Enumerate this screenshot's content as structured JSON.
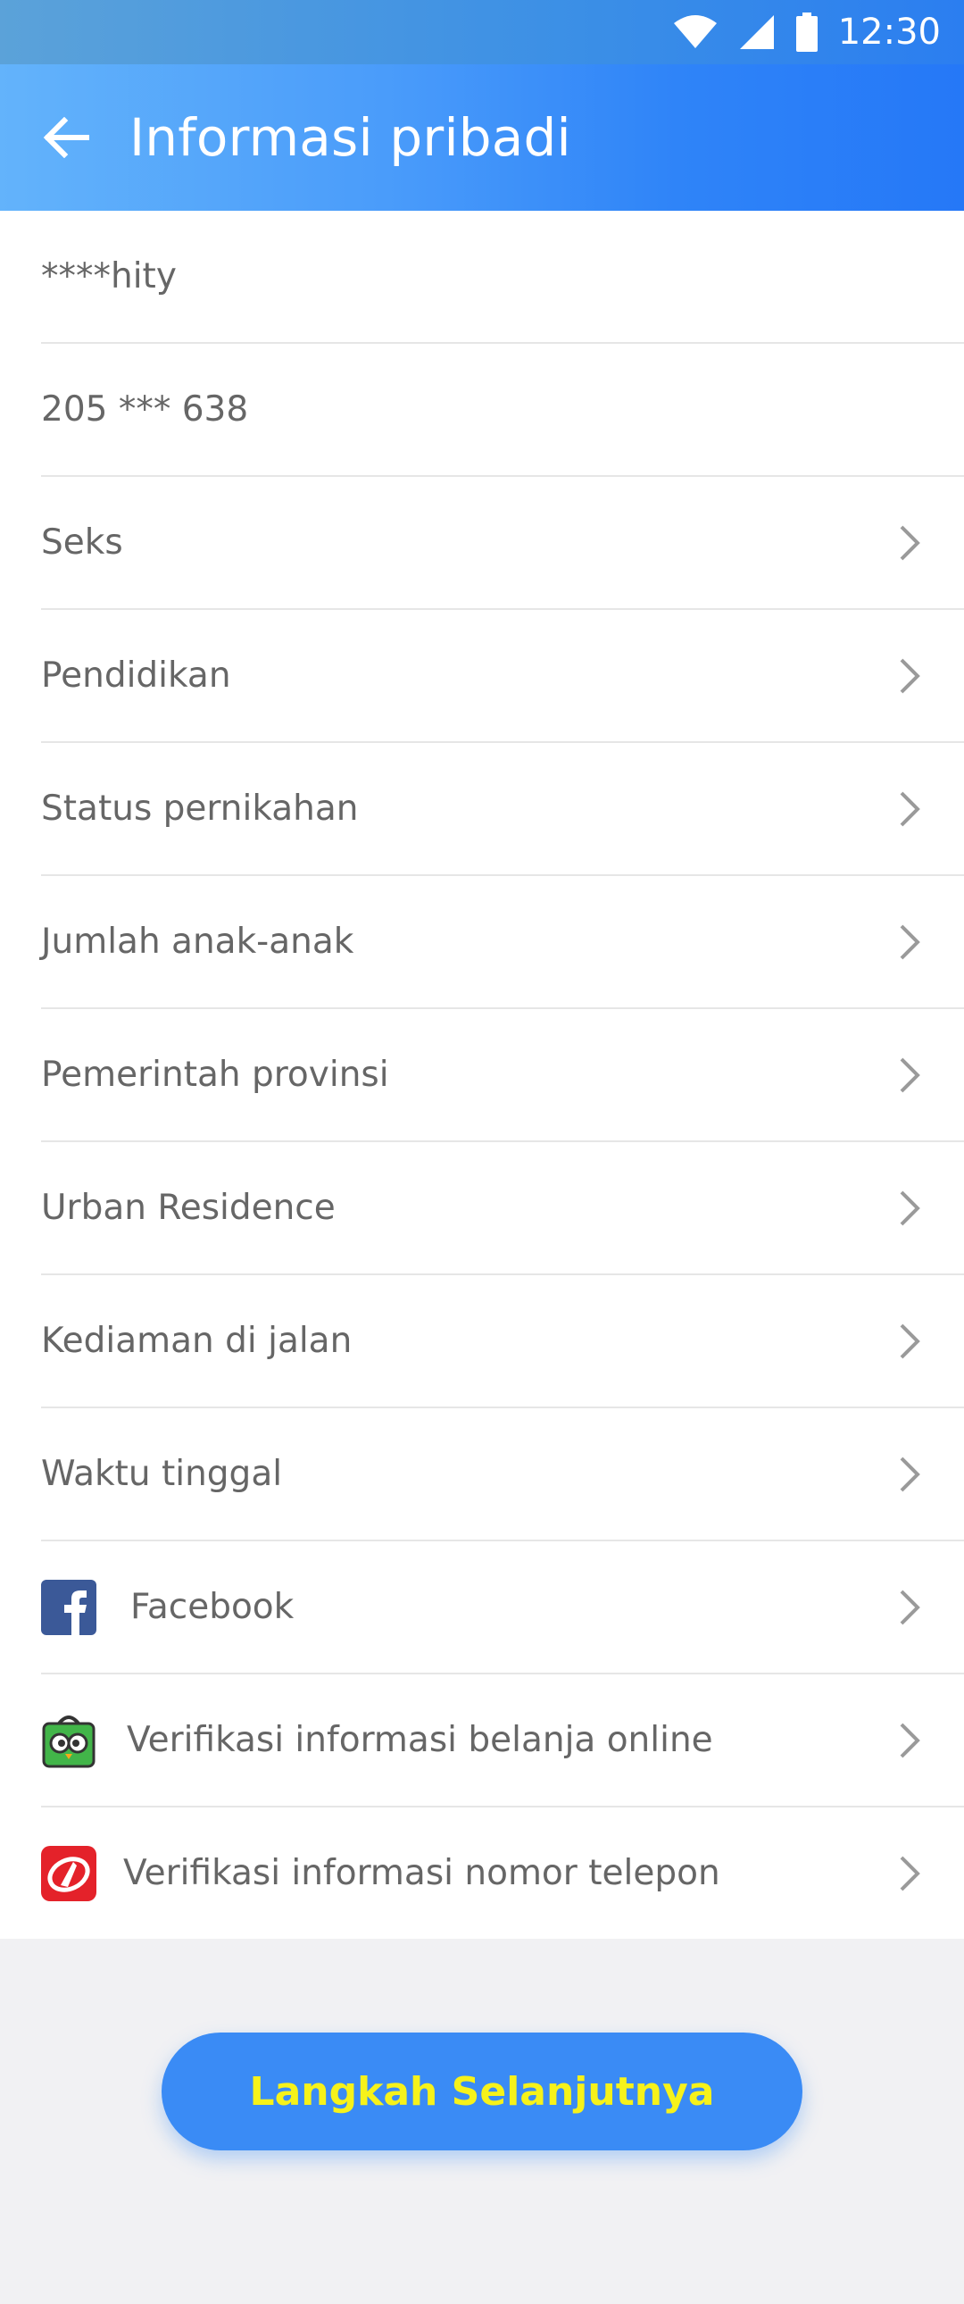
{
  "status_bar": {
    "time": "12:30"
  },
  "header": {
    "title": "Informasi pribadi"
  },
  "rows": [
    {
      "label": "****hity",
      "arrow": false
    },
    {
      "label": "205 *** 638",
      "arrow": false
    },
    {
      "label": "Seks",
      "arrow": true
    },
    {
      "label": "Pendidikan",
      "arrow": true
    },
    {
      "label": "Status pernikahan",
      "arrow": true
    },
    {
      "label": "Jumlah anak-anak",
      "arrow": true
    },
    {
      "label": "Pemerintah provinsi",
      "arrow": true
    },
    {
      "label": "Urban Residence",
      "arrow": true
    },
    {
      "label": "Kediaman di jalan",
      "arrow": true
    },
    {
      "label": "Waktu tinggal",
      "arrow": true
    }
  ],
  "verification": [
    {
      "label": "Facebook",
      "icon": "facebook-icon"
    },
    {
      "label": "Verifikasi informasi belanja online",
      "icon": "tokopedia-owl-icon"
    },
    {
      "label": "Verifikasi informasi nomor telepon",
      "icon": "telkomsel-icon"
    }
  ],
  "next_button": {
    "label": "Langkah Selanjutnya"
  },
  "colors": {
    "primary": "#3a8bf5",
    "button_text": "#f6f21a",
    "background": "#f1f1f3"
  }
}
